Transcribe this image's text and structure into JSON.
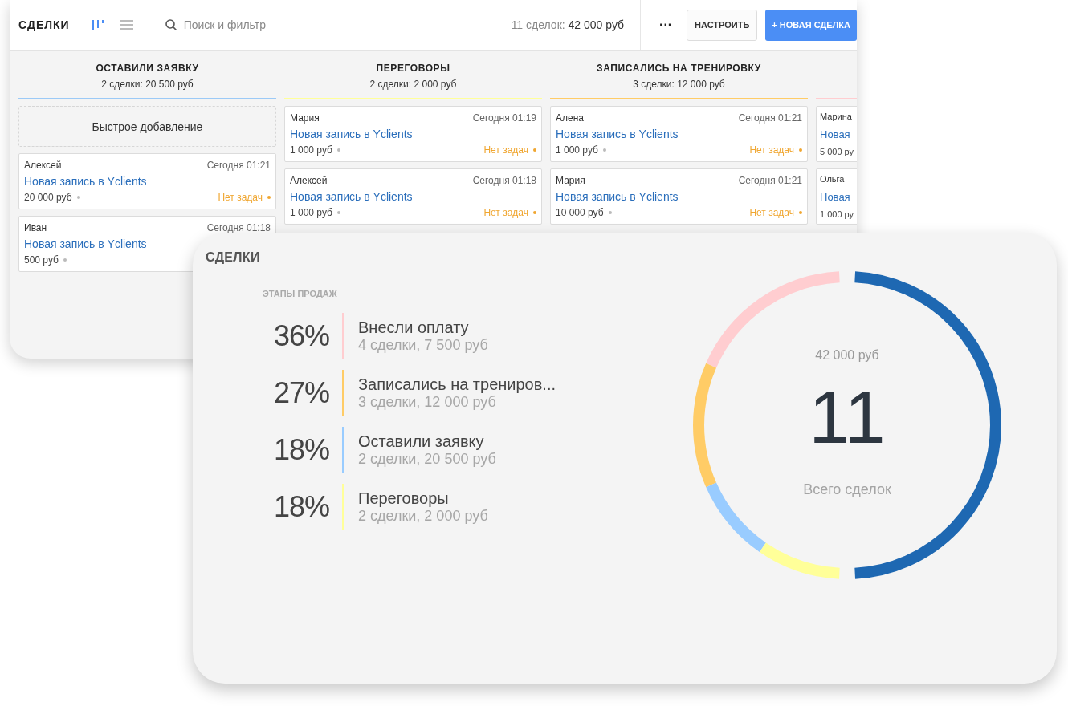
{
  "board_window": {
    "title": "СДЕЛКИ",
    "views": [
      {
        "kind": "board",
        "selected": true
      },
      {
        "kind": "list",
        "selected": false
      }
    ],
    "search": {
      "placeholder": "Поиск и фильтр"
    },
    "summary": {
      "count": "11 сделок:",
      "amount": "42 000 руб"
    },
    "more_button": "···",
    "settings_button": "НАСТРОИТЬ",
    "new_button": "+ НОВАЯ СДЕЛКА",
    "columns": [
      {
        "title": "ОСТАВИЛИ ЗАЯВКУ",
        "subtitle": "2 сделки: 20 500 руб",
        "color": "#9ccaf7",
        "quick_add": "Быстрое добавление",
        "cards": [
          {
            "name": "Алексей",
            "date": "Сегодня 01:21",
            "title": "Новая запись в Yclients",
            "amount": "20 000 руб",
            "tasks": "Нет задач"
          },
          {
            "name": "Иван",
            "date": "Сегодня 01:18",
            "title": "Новая запись в Yclients",
            "amount": "500 руб"
          }
        ]
      },
      {
        "title": "ПЕРЕГОВОРЫ",
        "subtitle": "2 сделки: 2 000 руб",
        "color": "#ffff99",
        "cards": [
          {
            "name": "Мария",
            "date": "Сегодня 01:19",
            "title": "Новая запись в Yclients",
            "amount": "1 000 руб",
            "tasks": "Нет задач"
          },
          {
            "name": "Алексей",
            "date": "Сегодня 01:18",
            "title": "Новая запись в Yclients",
            "amount": "1 000 руб",
            "tasks": "Нет задач"
          }
        ]
      },
      {
        "title": "ЗАПИСАЛИСЬ НА ТРЕНИРОВКУ",
        "subtitle": "3 сделки: 12 000 руб",
        "color": "#ffcc66",
        "cards": [
          {
            "name": "Алена",
            "date": "Сегодня 01:21",
            "title": "Новая запись в Yclients",
            "amount": "1 000 руб",
            "tasks": "Нет задач"
          },
          {
            "name": "Мария",
            "date": "Сегодня 01:21",
            "title": "Новая запись в Yclients",
            "amount": "10 000 руб",
            "tasks": "Нет задач"
          }
        ]
      },
      {
        "color": "#ffcdd0",
        "cards": [
          {
            "name": "Марина",
            "title": "Новая",
            "amount": "5 000 ру"
          },
          {
            "name": "Ольга",
            "title": "Новая",
            "amount": "1 000 ру"
          }
        ]
      }
    ]
  },
  "report": {
    "title": "СДЕЛКИ",
    "section": "ЭТАПЫ ПРОДАЖ",
    "stages": [
      {
        "percent": "36%",
        "name": "Внесли оплату",
        "details": "4 сделки, 7 500 руб",
        "color": "#ffcdd0"
      },
      {
        "percent": "27%",
        "name": "Записались на трениров...",
        "details": "3 сделки, 12 000 руб",
        "color": "#ffcc66"
      },
      {
        "percent": "18%",
        "name": "Оставили заявку",
        "details": "2 сделки, 20 500 руб",
        "color": "#99ccff"
      },
      {
        "percent": "18%",
        "name": "Переговоры",
        "details": "2 сделки, 2 000 руб",
        "color": "#ffff99"
      }
    ],
    "total": {
      "amount": "42 000 руб",
      "count": "11",
      "label": "Всего сделок"
    }
  }
}
